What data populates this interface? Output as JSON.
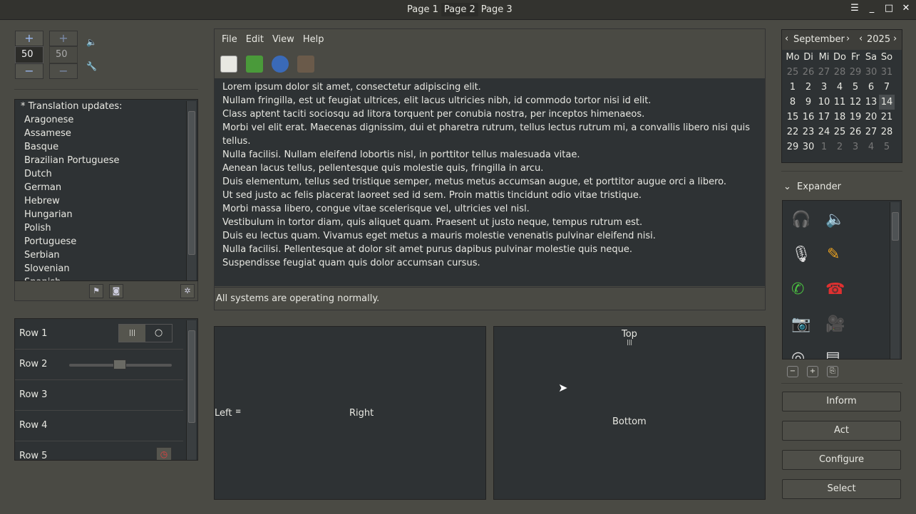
{
  "tabs": [
    "Page 1",
    "Page 2",
    "Page 3"
  ],
  "spin1": {
    "value": "50",
    "plus": "+",
    "minus": "−"
  },
  "spin2": {
    "value": "50",
    "plus": "+",
    "minus": "−"
  },
  "list": {
    "items": [
      "* Translation updates:",
      "Aragonese",
      "Assamese",
      "Basque",
      "Brazilian Portuguese",
      "Dutch",
      "German",
      "Hebrew",
      "Hungarian",
      "Polish",
      "Portuguese",
      "Serbian",
      "Slovenian",
      "Spanish"
    ]
  },
  "rows": [
    "Row 1",
    "Row 2",
    "Row 3",
    "Row 4",
    "Row 5"
  ],
  "menu": [
    "File",
    "Edit",
    "View",
    "Help"
  ],
  "text_lines": [
    "Lorem ipsum dolor sit amet, consectetur adipiscing elit.",
    "Nullam fringilla, est ut feugiat ultrices, elit lacus ultricies nibh, id commodo tortor nisi id elit.",
    "Class aptent taciti sociosqu ad litora torquent per conubia nostra, per inceptos himenaeos.",
    "Morbi vel elit erat. Maecenas dignissim, dui et pharetra rutrum, tellus lectus rutrum mi, a convallis libero nisi quis tellus.",
    "Nulla facilisi. Nullam eleifend lobortis nisl, in porttitor tellus malesuada vitae.",
    "Aenean lacus tellus, pellentesque quis molestie quis, fringilla in arcu.",
    "Duis elementum, tellus sed tristique semper, metus metus accumsan augue, et porttitor augue orci a libero.",
    "Ut sed justo ac felis placerat laoreet sed id sem. Proin mattis tincidunt odio vitae tristique.",
    "Morbi massa libero, congue vitae scelerisque vel, ultricies vel nisl.",
    "Vestibulum in tortor diam, quis aliquet quam. Praesent ut justo neque, tempus rutrum est.",
    "Duis eu lectus quam. Vivamus eget metus a mauris molestie venenatis pulvinar eleifend nisi.",
    "Nulla facilisi. Pellentesque at dolor sit amet purus dapibus pulvinar molestie quis neque.",
    "Suspendisse feugiat quam quis dolor accumsan cursus."
  ],
  "status": "All systems are operating normally.",
  "paned": {
    "left": "Left",
    "right": "Right",
    "top": "Top",
    "bottom": "Bottom"
  },
  "calendar": {
    "month": "September",
    "year": "2025",
    "weekdays": [
      "Mo",
      "Di",
      "Mi",
      "Do",
      "Fr",
      "Sa",
      "So"
    ],
    "days": [
      [
        "25",
        "26",
        "27",
        "28",
        "29",
        "30",
        "31"
      ],
      [
        "1",
        "2",
        "3",
        "4",
        "5",
        "6",
        "7"
      ],
      [
        "8",
        "9",
        "10",
        "11",
        "12",
        "13",
        "14"
      ],
      [
        "15",
        "16",
        "17",
        "18",
        "19",
        "20",
        "21"
      ],
      [
        "22",
        "23",
        "24",
        "25",
        "26",
        "27",
        "28"
      ],
      [
        "29",
        "30",
        "1",
        "2",
        "3",
        "4",
        "5"
      ]
    ],
    "selected": "14"
  },
  "expander": "Expander",
  "buttons": [
    "Inform",
    "Act",
    "Configure",
    "Select"
  ],
  "colors": {
    "bg": "#4a4a44",
    "field": "#2e3234",
    "accent": "#9ab8f0"
  }
}
